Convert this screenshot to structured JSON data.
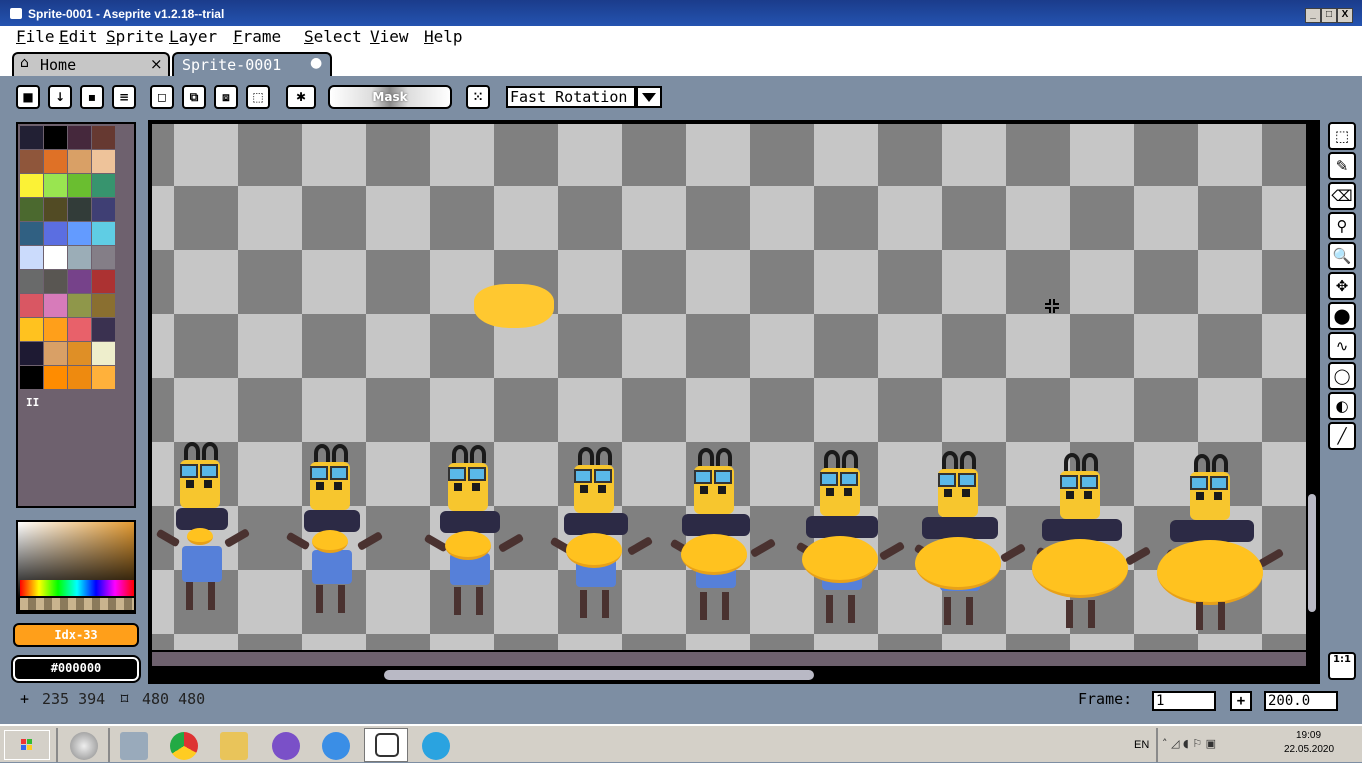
{
  "window": {
    "title": "Sprite-0001 - Aseprite v1.2.18--trial",
    "controls": [
      "_",
      "□",
      "X"
    ]
  },
  "menu": {
    "items": [
      "File",
      "Edit",
      "Sprite",
      "Layer",
      "Frame",
      "Select",
      "View",
      "Help"
    ]
  },
  "tabs": {
    "home": {
      "label": "Home",
      "close": "×"
    },
    "sprite": {
      "label": "Sprite-0001",
      "modified": "●"
    }
  },
  "toolbar": {
    "mask_label": "Mask",
    "rotation_value": "Fast Rotation"
  },
  "palette": {
    "colors": [
      "#222034",
      "#000000",
      "#45283c",
      "#663931",
      "#8f563b",
      "#df7126",
      "#d9a066",
      "#eec39a",
      "#fbf236",
      "#99e550",
      "#6abe30",
      "#37946e",
      "#4b692f",
      "#524b24",
      "#323c39",
      "#3f3f74",
      "#306082",
      "#5b6ee1",
      "#639bff",
      "#5fcde4",
      "#cbdbfc",
      "#ffffff",
      "#9badb7",
      "#847e87",
      "#696a6a",
      "#595652",
      "#76428a",
      "#ac3232",
      "#d95763",
      "#d77bba",
      "#8f974a",
      "#8a6f30",
      "#ffc21f",
      "#ff9f1a",
      "#e8616a",
      "#3a3150",
      "#1e1a33",
      "#d9a066",
      "#df8f26",
      "#eeeecc",
      "#000000",
      "#ff8c00",
      "#ee8a0f",
      "#ffb13b"
    ],
    "extra_glyph": "II"
  },
  "color": {
    "index_label": "Idx-33",
    "hex_label": "#000000"
  },
  "right_tools": [
    {
      "name": "rectangular-marquee-tool",
      "glyph": "⬚"
    },
    {
      "name": "pencil-tool",
      "glyph": "✎"
    },
    {
      "name": "eraser-tool",
      "glyph": "⌫"
    },
    {
      "name": "eyedropper-tool",
      "glyph": "⚲"
    },
    {
      "name": "zoom-tool",
      "glyph": "🔍"
    },
    {
      "name": "move-tool",
      "glyph": "✥"
    },
    {
      "name": "paint-bucket-tool",
      "glyph": "⬤"
    },
    {
      "name": "curve-tool",
      "glyph": "∿"
    },
    {
      "name": "ellipse-tool",
      "glyph": "◯"
    },
    {
      "name": "contour-tool",
      "glyph": "◐"
    },
    {
      "name": "blur-tool",
      "glyph": "╱"
    }
  ],
  "zoom_reset_label": "1:1",
  "status": {
    "cursor_pos": "235 394",
    "sprite_size": "480 480",
    "frame_label": "Frame:",
    "frame_value": "1",
    "add_frame_label": "+",
    "zoom_value": "200.0"
  },
  "taskbar": {
    "language": "EN",
    "time": "19:09",
    "date": "22.05.2020"
  }
}
